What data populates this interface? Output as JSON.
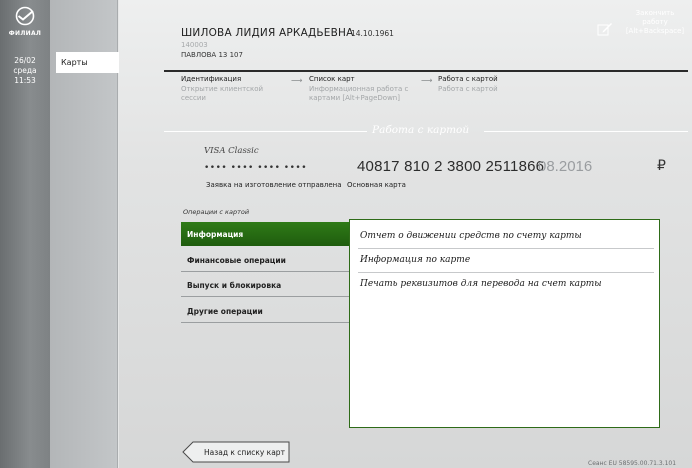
{
  "sidebar": {
    "logo_text": "ФИЛИАЛ",
    "date_day": "26/02",
    "weekday": "среда",
    "time": "11:53"
  },
  "nav": {
    "active_label": "Карты"
  },
  "client": {
    "name": "ШИЛОВА ЛИДИЯ АРКАДЬЕВНА",
    "dob": "14.10.1961",
    "id": "140003",
    "branch": "ПАВЛОВА 13 107"
  },
  "finish": {
    "line1": "Закончить",
    "line2": "работу",
    "line3": "[Alt+Backspace]"
  },
  "steps": [
    {
      "title": "Идентификация",
      "sub1": "Открытие клиентской",
      "sub2": "сессии"
    },
    {
      "title": "Список карт",
      "sub1": "Информационная работа с",
      "sub2": "картами [Alt+PageDown]"
    },
    {
      "title": "Работа с картой",
      "sub1": "Работа с картой",
      "sub2": ""
    }
  ],
  "section": {
    "title": "Работа с картой"
  },
  "card": {
    "type": "VISA Classic",
    "masked": "•••• •••• •••• ••••",
    "number": "40817 810 2 3800 2511866",
    "expiry": "08.2016",
    "currency": "₽",
    "status": "Заявка на изготовление отправлена",
    "kind": "Основная карта"
  },
  "operations": {
    "label": "Операции с картой",
    "items": [
      "Информация",
      "Финансовые операции",
      "Выпуск и блокировка",
      "Другие операции"
    ]
  },
  "panel": {
    "items": [
      "Отчет о движении средств по счету карты",
      "Информация по карте",
      "Печать реквизитов для перевода на счет карты"
    ]
  },
  "back_button": {
    "label": "Назад к списку карт"
  },
  "footer": {
    "version": "Сеанс EU 58595.00.71.3.101"
  },
  "colors": {
    "accent_green": "#2f7b17",
    "rail": "#7e8284",
    "background": "#e6e7e7"
  }
}
